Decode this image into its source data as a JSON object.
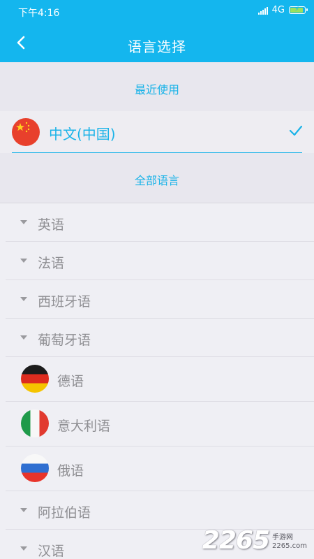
{
  "status_bar": {
    "time": "下午4:16",
    "network": "4G"
  },
  "header": {
    "title": "语言选择"
  },
  "recent": {
    "label": "最近使用",
    "current_language": "中文(中国)"
  },
  "all": {
    "label": "全部语言"
  },
  "languages": [
    {
      "name": "英语",
      "type": "expandable"
    },
    {
      "name": "法语",
      "type": "expandable"
    },
    {
      "name": "西班牙语",
      "type": "expandable"
    },
    {
      "name": "葡萄牙语",
      "type": "expandable"
    },
    {
      "name": "德语",
      "type": "flag",
      "flag": "germany-flag-icon"
    },
    {
      "name": "意大利语",
      "type": "flag",
      "flag": "italy-flag-icon"
    },
    {
      "name": "俄语",
      "type": "flag",
      "flag": "russia-flag-icon"
    },
    {
      "name": "阿拉伯语",
      "type": "expandable"
    },
    {
      "name": "汉语",
      "type": "expandable"
    }
  ],
  "watermark": {
    "number": "2265",
    "site_cn": "手游网",
    "site_url": "2265.com"
  },
  "colors": {
    "primary": "#14b6ee",
    "accent_text": "#1ab3e8",
    "list_text": "#8f8f93"
  }
}
